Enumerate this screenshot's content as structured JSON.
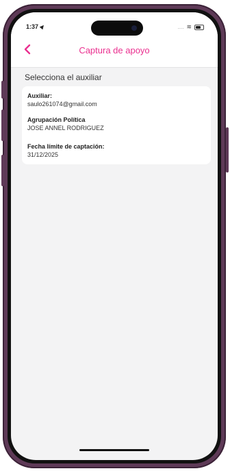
{
  "status_bar": {
    "time": "1:37",
    "signal": "....",
    "wifi_glyph": "≋"
  },
  "header": {
    "title": "Captura de apoyo",
    "back_icon": "chevron-left-icon"
  },
  "section": {
    "title": "Selecciona el auxiliar"
  },
  "card": {
    "fields": [
      {
        "label": "Auxiliar:",
        "value": "saulo261074@gmail.com"
      },
      {
        "label": "Agrupación Política",
        "value": "JOSE ANNEL RODRIGUEZ"
      },
      {
        "label": "Fecha límite de captación:",
        "value": "31/12/2025"
      }
    ]
  },
  "colors": {
    "accent": "#ea2f8f",
    "frame": "#5e3a57",
    "background": "#f3f3f4"
  }
}
